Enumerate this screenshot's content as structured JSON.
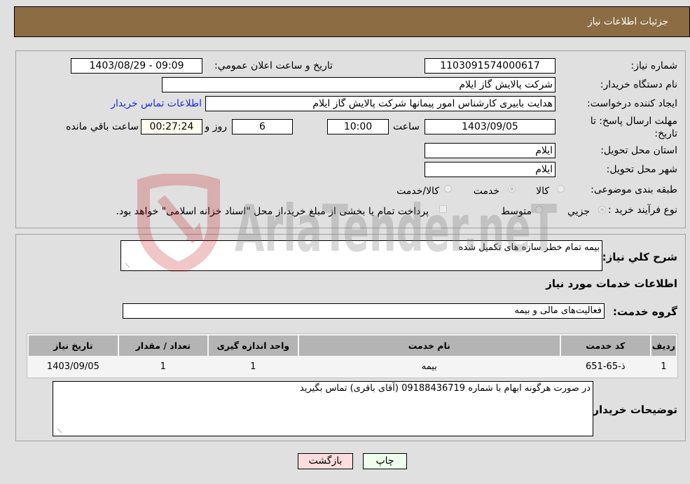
{
  "header": {
    "title": "جزئیات اطلاعات نیاز"
  },
  "form": {
    "need_number_label": "شماره نیاز:",
    "need_number": "1103091574000617",
    "announce_label": "تاریخ و ساعت اعلان عمومي:",
    "announce_value": "1403/08/29 - 09:09",
    "buyer_org_label": "نام دستگاه خریدار:",
    "buyer_org": "شرکت پالایش گاز ایلام",
    "creator_label": "ایجاد کننده درخواست:",
    "creator": "هدایت بابیری کارشناس امور پیمانها شرکت پالایش گاز ایلام",
    "buyer_contact_link": "اطلاعات تماس خریدار",
    "deadline_label": "مهلت ارسال پاسخ: تا تاریخ:",
    "deadline_date": "1403/09/05",
    "time_label": "ساعت",
    "deadline_time": "10:00",
    "days_value": "6",
    "days_label": "روز و",
    "remaining_time": "00:27:24",
    "remaining_label": "ساعت باقي مانده",
    "province_label": "استان محل تحویل:",
    "province": "ایلام",
    "city_label": "شهر محل تحویل:",
    "city": "ایلام",
    "category_label": "طبقه بندی موضوعی:",
    "category_options": [
      {
        "label": "کالا",
        "selected": false
      },
      {
        "label": "خدمت",
        "selected": true
      },
      {
        "label": "کالا/خدمت",
        "selected": false
      }
    ],
    "process_label": "نوع فرآیند خرید :",
    "process_options": [
      {
        "label": "جزيي",
        "selected": true
      },
      {
        "label": "متوسط",
        "selected": false
      }
    ],
    "treasury_checkbox_label": "پرداخت تمام یا بخشی از مبلغ خرید،از محل \"اسناد خزانه اسلامی\" خواهد بود.",
    "treasury_checked": false
  },
  "details": {
    "description_label": "شرح کلي نیاز:",
    "description": "بیمه تمام خطر سازه های تکمیل شده",
    "services_heading": "اطلاعات خدمات مورد نیاز",
    "service_group_label": "گروه خدمت:",
    "service_group": "فعالیت‌های مالی و بیمه",
    "table": {
      "headers": [
        "ردیف",
        "کد خدمت",
        "نام خدمت",
        "واحد اندازه گیری",
        "تعداد / مقدار",
        "تاریخ نیاز"
      ],
      "rows": [
        [
          "1",
          "ذ-65-651",
          "بیمه",
          "1",
          "1",
          "1403/09/05"
        ]
      ]
    },
    "buyer_notes_label": "توضیحات خریدار:",
    "buyer_notes": "در صورت هرگونه ابهام با شماره 09188436719 (آقای باقری) تماس بگیرید"
  },
  "buttons": {
    "print": "چاپ",
    "back": "بازگشت"
  },
  "watermark": {
    "text": "AriaTender.neT"
  }
}
